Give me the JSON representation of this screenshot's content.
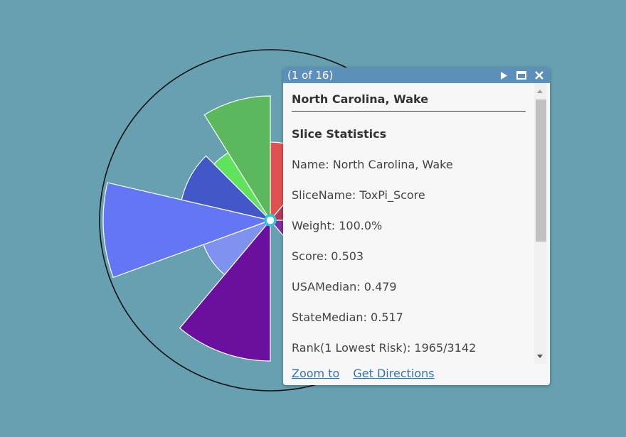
{
  "map": {
    "background_color": "#66a0b1",
    "slices": [
      {
        "color": "#e05252"
      },
      {
        "color": "#b23c56"
      },
      {
        "color": "#7b2fa2"
      },
      {
        "color": "#6a0f9e"
      },
      {
        "color": "#8092f0"
      },
      {
        "color": "#6377f5"
      },
      {
        "color": "#4257c8"
      },
      {
        "color": "#60e35c"
      },
      {
        "color": "#5cb85c"
      }
    ],
    "selection_marker_color": "#29c6e0"
  },
  "popup": {
    "counter": "(1 of 16)",
    "header_color": "#5d8fbb",
    "title": "North Carolina, Wake",
    "section_title": "Slice Statistics",
    "fields": [
      {
        "label": "Name:",
        "value": "North Carolina, Wake"
      },
      {
        "label": "SliceName:",
        "value": "ToxPi_Score"
      },
      {
        "label": "Weight:",
        "value": "100.0%"
      },
      {
        "label": "Score:",
        "value": "0.503"
      },
      {
        "label": "USAMedian:",
        "value": "0.479"
      },
      {
        "label": "StateMedian:",
        "value": "0.517"
      },
      {
        "label": "Rank(1 Lowest Risk):",
        "value": "1965/3142"
      }
    ],
    "actions": {
      "zoom": "Zoom to",
      "directions": "Get Directions"
    },
    "icons": [
      "play-icon",
      "maximize-icon",
      "close-icon"
    ]
  }
}
